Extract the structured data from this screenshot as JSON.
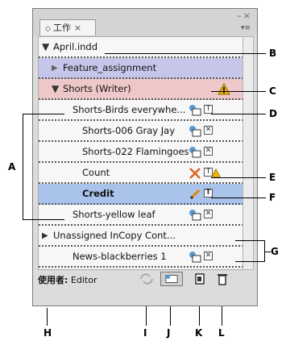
{
  "panel": {
    "tab_label": "工作",
    "tab_close": "×",
    "sort_glyph": "◇",
    "window_controls": "–×",
    "menu_glyph": "▾≡"
  },
  "rows": [
    {
      "label": "April.indd",
      "kind": "doc",
      "expanded": true
    },
    {
      "label": "Feature_assignment",
      "kind": "assignment",
      "expanded": false
    },
    {
      "label": "Shorts (Writer)",
      "kind": "assignment-open",
      "expanded": true
    },
    {
      "label": "Shorts-Birds everywhe...",
      "kind": "story"
    },
    {
      "label": "Shorts-006 Gray Jay",
      "kind": "story"
    },
    {
      "label": "Shorts-022 Flamingoes",
      "kind": "story"
    },
    {
      "label": "Count",
      "kind": "story"
    },
    {
      "label": "Credit",
      "kind": "story-selected"
    },
    {
      "label": "Shorts-yellow leaf",
      "kind": "story"
    },
    {
      "label": "Unassigned InCopy Cont...",
      "kind": "group",
      "expanded": false
    },
    {
      "label": "News-blackberries 1",
      "kind": "story"
    }
  ],
  "status": {
    "user_label": "使用者:",
    "user_name": "Editor"
  },
  "callouts": {
    "A": "A",
    "B": "B",
    "C": "C",
    "D": "D",
    "E": "E",
    "F": "F",
    "G": "G",
    "H": "H",
    "I": "I",
    "J": "J",
    "K": "K",
    "L": "L"
  },
  "colors": {
    "assignment_row": "#c6c6ea",
    "open_assignment_row": "#eec8c8",
    "selected_row": "#a9c3ea",
    "warning": "#f0b400"
  }
}
